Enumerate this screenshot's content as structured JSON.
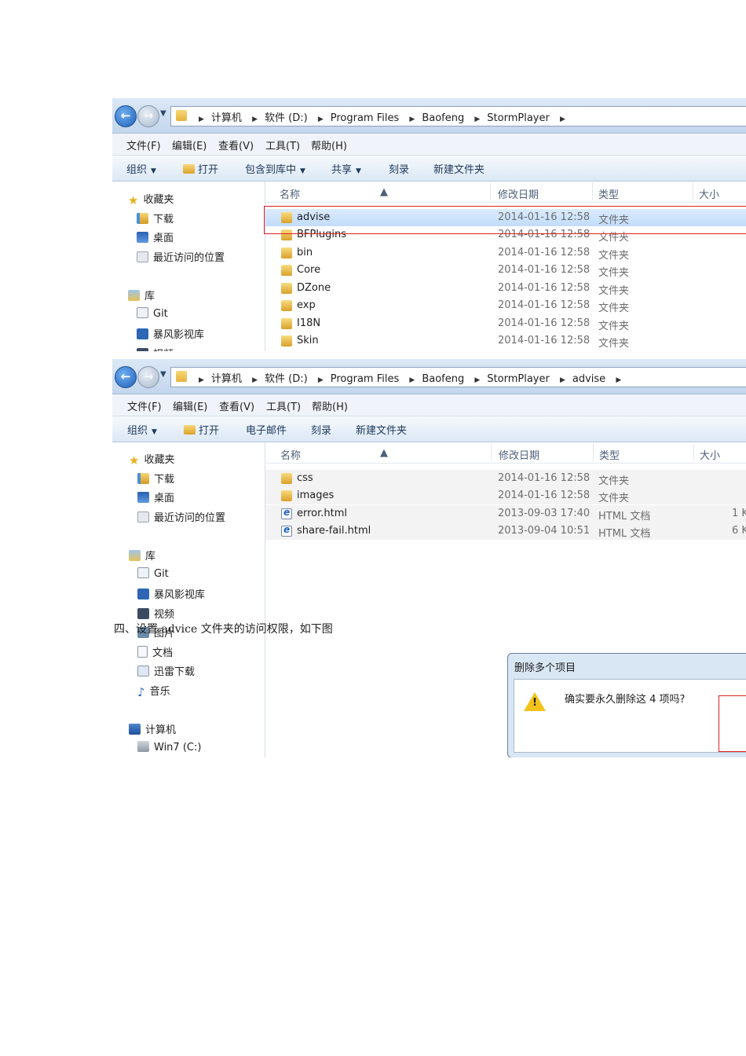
{
  "shot1": {
    "breadcrumbs": [
      "计算机",
      "软件 (D:)",
      "Program Files",
      "Baofeng",
      "StormPlayer"
    ],
    "menu": [
      "文件(F)",
      "编辑(E)",
      "查看(V)",
      "工具(T)",
      "帮助(H)"
    ],
    "toolbar": {
      "organize": "组织",
      "open": "打开",
      "include_library": "包含到库中",
      "share": "共享",
      "burn": "刻录",
      "new_folder": "新建文件夹"
    },
    "nav": {
      "favorites": "收藏夹",
      "downloads": "下载",
      "desktop": "桌面",
      "recent": "最近访问的位置",
      "libraries": "库",
      "git": "Git",
      "storm_library": "暴风影视库",
      "videos": "视频"
    },
    "columns": {
      "name": "名称",
      "date": "修改日期",
      "type": "类型",
      "size": "大小"
    },
    "rows": [
      {
        "name": "advise",
        "date": "2014-01-16 12:58",
        "type": "文件夹"
      },
      {
        "name": "BFPlugins",
        "date": "2014-01-16 12:58",
        "type": "文件夹"
      },
      {
        "name": "bin",
        "date": "2014-01-16 12:58",
        "type": "文件夹"
      },
      {
        "name": "Core",
        "date": "2014-01-16 12:58",
        "type": "文件夹"
      },
      {
        "name": "DZone",
        "date": "2014-01-16 12:58",
        "type": "文件夹"
      },
      {
        "name": "exp",
        "date": "2014-01-16 12:58",
        "type": "文件夹"
      },
      {
        "name": "I18N",
        "date": "2014-01-16 12:58",
        "type": "文件夹"
      },
      {
        "name": "Skin",
        "date": "2014-01-16 12:58",
        "type": "文件夹"
      }
    ]
  },
  "shot2": {
    "breadcrumbs": [
      "计算机",
      "软件 (D:)",
      "Program Files",
      "Baofeng",
      "StormPlayer",
      "advise"
    ],
    "menu": [
      "文件(F)",
      "编辑(E)",
      "查看(V)",
      "工具(T)",
      "帮助(H)"
    ],
    "toolbar": {
      "organize": "组织",
      "open": "打开",
      "email": "电子邮件",
      "burn": "刻录",
      "new_folder": "新建文件夹"
    },
    "nav": {
      "favorites": "收藏夹",
      "downloads": "下载",
      "desktop": "桌面",
      "recent": "最近访问的位置",
      "libraries": "库",
      "git": "Git",
      "storm_library": "暴风影视库",
      "videos": "视频",
      "pictures": "图片",
      "documents": "文档",
      "thunder": "迅雷下载",
      "music": "音乐",
      "computer": "计算机",
      "drive_c": "Win7 (C:)"
    },
    "columns": {
      "name": "名称",
      "date": "修改日期",
      "type": "类型",
      "size": "大小"
    },
    "rows": [
      {
        "name": "css",
        "date": "2014-01-16 12:58",
        "type": "文件夹",
        "size": ""
      },
      {
        "name": "images",
        "date": "2014-01-16 12:58",
        "type": "文件夹",
        "size": ""
      },
      {
        "name": "error.html",
        "date": "2013-09-03 17:40",
        "type": "HTML 文档",
        "size": "1 K"
      },
      {
        "name": "share-fail.html",
        "date": "2013-09-04 10:51",
        "type": "HTML 文档",
        "size": "6 K"
      }
    ],
    "dialog": {
      "title": "删除多个项目",
      "message": "确实要永久删除这 4 项吗?",
      "warn_glyph": "!"
    }
  },
  "caption": "四、设置 advice 文件夹的访问权限，如下图",
  "colors": {
    "highlight_box": "#e02020",
    "selection": "#c1dcfb",
    "toolbar_text": "#1e395b"
  }
}
